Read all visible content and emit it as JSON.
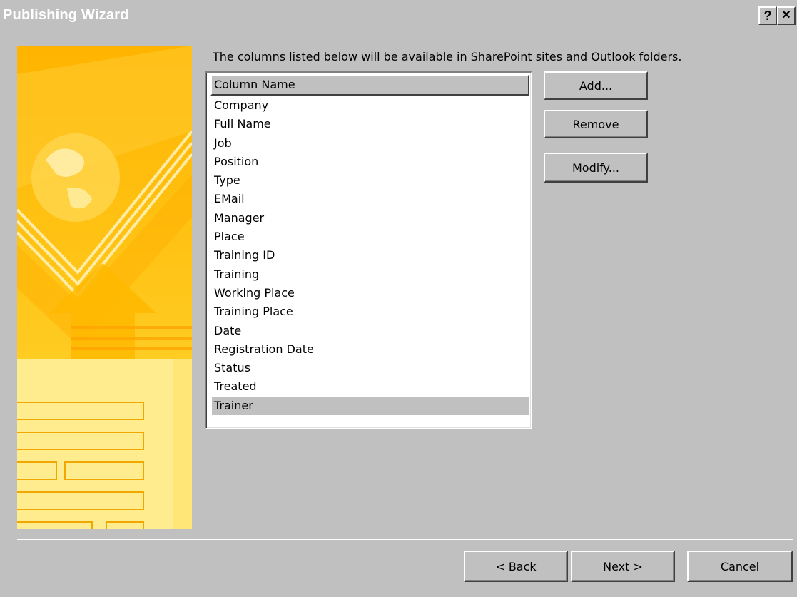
{
  "window": {
    "title": "Publishing Wizard",
    "help_button": "?",
    "close_button": "✕"
  },
  "intro_text": "The columns listed below will be available in SharePoint sites and Outlook folders.",
  "list": {
    "header": "Column Name",
    "items": [
      "Company",
      "Full Name",
      "Job",
      "Position",
      "Type",
      "EMail",
      "Manager",
      "Place",
      "Training ID",
      "Training",
      "Working Place",
      "Training Place",
      "Date",
      "Registration Date",
      "Status",
      "Treated",
      "Trainer"
    ],
    "selected": "Trainer"
  },
  "actions": {
    "add": "Add...",
    "remove": "Remove",
    "modify": "Modify..."
  },
  "footer": {
    "back": "< Back",
    "next": "Next >",
    "cancel": "Cancel"
  },
  "colors": {
    "face": "#c0c0c0",
    "highlight": "#ffffff",
    "shadow": "#404040",
    "art_yellow": "#ffc40a"
  }
}
